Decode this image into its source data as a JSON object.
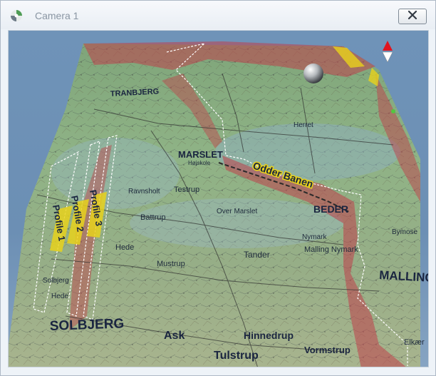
{
  "window": {
    "title": "Camera 1"
  },
  "icons": {
    "app": "app-logo-icon",
    "close": "close-icon",
    "navigation": "north-arrow-icon"
  },
  "colors": {
    "terrain_red": "#c0404a",
    "profile_yellow": "#e8d21c",
    "sky_blue": "#7093b8"
  },
  "map": {
    "towns": [
      "TRANBJERG",
      "MARSLET",
      "BEDER",
      "MALLING",
      "SOLBJERG",
      "Tulstrup",
      "Hinnedrup",
      "Vormstrup",
      "Ask"
    ],
    "places": [
      "Testrup",
      "Battrup",
      "Over Marslet",
      "Nymark",
      "Malling Nymark",
      "Tander",
      "Mustrup",
      "Hede",
      "Solbjerg",
      "Hede",
      "Bymose",
      "Elkær",
      "Herret",
      "Ravnsholt",
      "Højskole"
    ],
    "railway": "Odder Banen",
    "profiles": [
      "Profile 1",
      "Profile 2",
      "Profile 3"
    ]
  }
}
